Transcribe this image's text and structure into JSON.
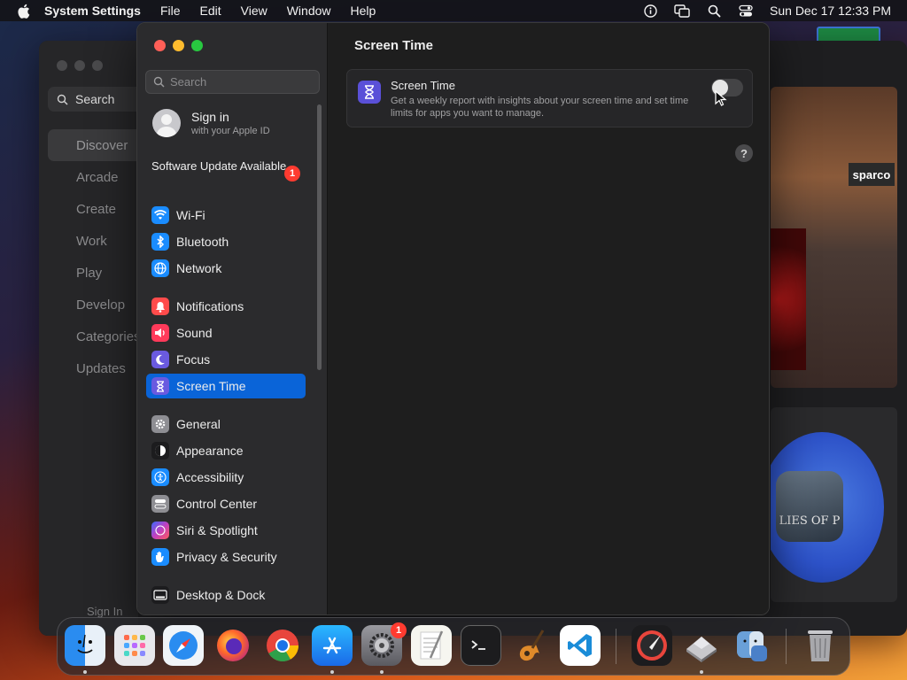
{
  "menubar": {
    "app_name": "System Settings",
    "menus": [
      "File",
      "Edit",
      "View",
      "Window",
      "Help"
    ],
    "clock": "Sun Dec 17  12:33 PM"
  },
  "background_app": {
    "search_label": "Search",
    "nav": [
      "Discover",
      "Arcade",
      "Create",
      "Work",
      "Play",
      "Develop",
      "Categories",
      "Updates"
    ],
    "sign_in": "Sign In",
    "banner_text": "sparco",
    "game_icon_text": "LIES OF P"
  },
  "sidebar": {
    "search_placeholder": "Search",
    "account": {
      "name": "Sign in",
      "sub": "with your Apple ID"
    },
    "update": {
      "label": "Software Update Available",
      "badge": "1"
    },
    "items": [
      {
        "label": "Wi-Fi",
        "icon": "wifi-icon",
        "color": "#1a8cff"
      },
      {
        "label": "Bluetooth",
        "icon": "bluetooth-icon",
        "color": "#1a8cff"
      },
      {
        "label": "Network",
        "icon": "globe-icon",
        "color": "#1a8cff"
      },
      {
        "label": "Notifications",
        "icon": "bell-icon",
        "color": "#ff4b4b"
      },
      {
        "label": "Sound",
        "icon": "speaker-icon",
        "color": "#ff3a5a"
      },
      {
        "label": "Focus",
        "icon": "moon-icon",
        "color": "#6a5ae0"
      },
      {
        "label": "Screen Time",
        "icon": "hourglass-icon",
        "color": "#6a5ae0"
      },
      {
        "label": "General",
        "icon": "gear-icon",
        "color": "#8e8e93"
      },
      {
        "label": "Appearance",
        "icon": "appearance-icon",
        "color": "#1c1c1e"
      },
      {
        "label": "Accessibility",
        "icon": "accessibility-icon",
        "color": "#1a8cff"
      },
      {
        "label": "Control Center",
        "icon": "control-center-icon",
        "color": "#8e8e93"
      },
      {
        "label": "Siri & Spotlight",
        "icon": "siri-icon",
        "color": "#c040c0"
      },
      {
        "label": "Privacy & Security",
        "icon": "hand-icon",
        "color": "#1a8cff"
      },
      {
        "label": "Desktop & Dock",
        "icon": "dock-icon",
        "color": "#1c1c1e"
      }
    ]
  },
  "content": {
    "title": "Screen Time",
    "card": {
      "label": "Screen Time",
      "description": "Get a weekly report with insights about your screen time and set time limits for apps you want to manage.",
      "toggle_on": false
    },
    "help": "?"
  },
  "dock": {
    "settings_badge": "1",
    "apps": [
      "Finder",
      "Launchpad",
      "Safari",
      "Firefox",
      "Chrome",
      "App Store",
      "System Settings",
      "TextEdit",
      "Terminal",
      "GarageBand",
      "VS Code",
      "Compass",
      "Disk Utility",
      "Finder Alt",
      "Trash"
    ]
  },
  "colors": {
    "accent": "#0a64d8",
    "sidebar_bg": "#2b2b2d",
    "content_bg": "#1e1e1e"
  }
}
